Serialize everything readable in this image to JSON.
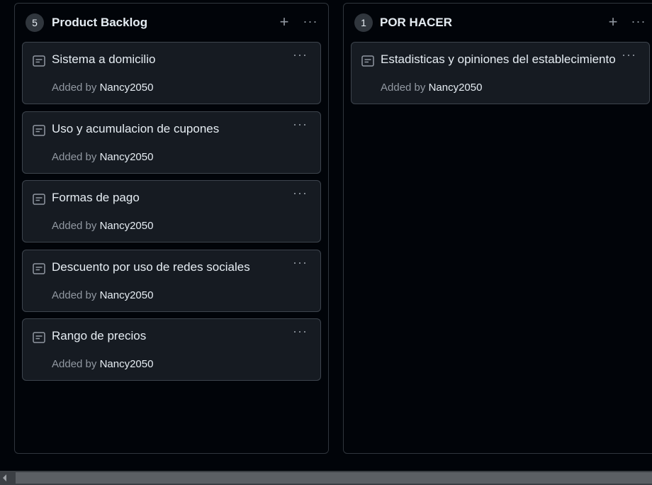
{
  "columns": [
    {
      "count": "5",
      "title": "Product Backlog",
      "add_label": "+",
      "menu_label": "···",
      "cards": [
        {
          "title": "Sistema a domicilio",
          "added_by_label": "Added by",
          "user": "Nancy2050",
          "menu_label": "···"
        },
        {
          "title": "Uso y acumulacion de cupones",
          "added_by_label": "Added by",
          "user": "Nancy2050",
          "menu_label": "···"
        },
        {
          "title": "Formas de pago",
          "added_by_label": "Added by",
          "user": "Nancy2050",
          "menu_label": "···"
        },
        {
          "title": "Descuento por uso de redes sociales",
          "added_by_label": "Added by",
          "user": "Nancy2050",
          "menu_label": "···"
        },
        {
          "title": "Rango de precios",
          "added_by_label": "Added by",
          "user": "Nancy2050",
          "menu_label": "···"
        }
      ]
    },
    {
      "count": "1",
      "title": "POR HACER",
      "add_label": "+",
      "menu_label": "···",
      "cards": [
        {
          "title": "Estadisticas y opiniones del establecimiento",
          "added_by_label": "Added by",
          "user": "Nancy2050",
          "menu_label": "···"
        }
      ]
    }
  ],
  "icons": {
    "card": "note-icon",
    "add": "plus-icon",
    "menu": "kebab-horizontal-icon",
    "scroll_left": "scroll-left-arrow-icon"
  },
  "colors": {
    "background": "#010409",
    "card": "#161b22",
    "border": "#30363d",
    "text": "#e6edf3",
    "muted": "#9198a1"
  }
}
